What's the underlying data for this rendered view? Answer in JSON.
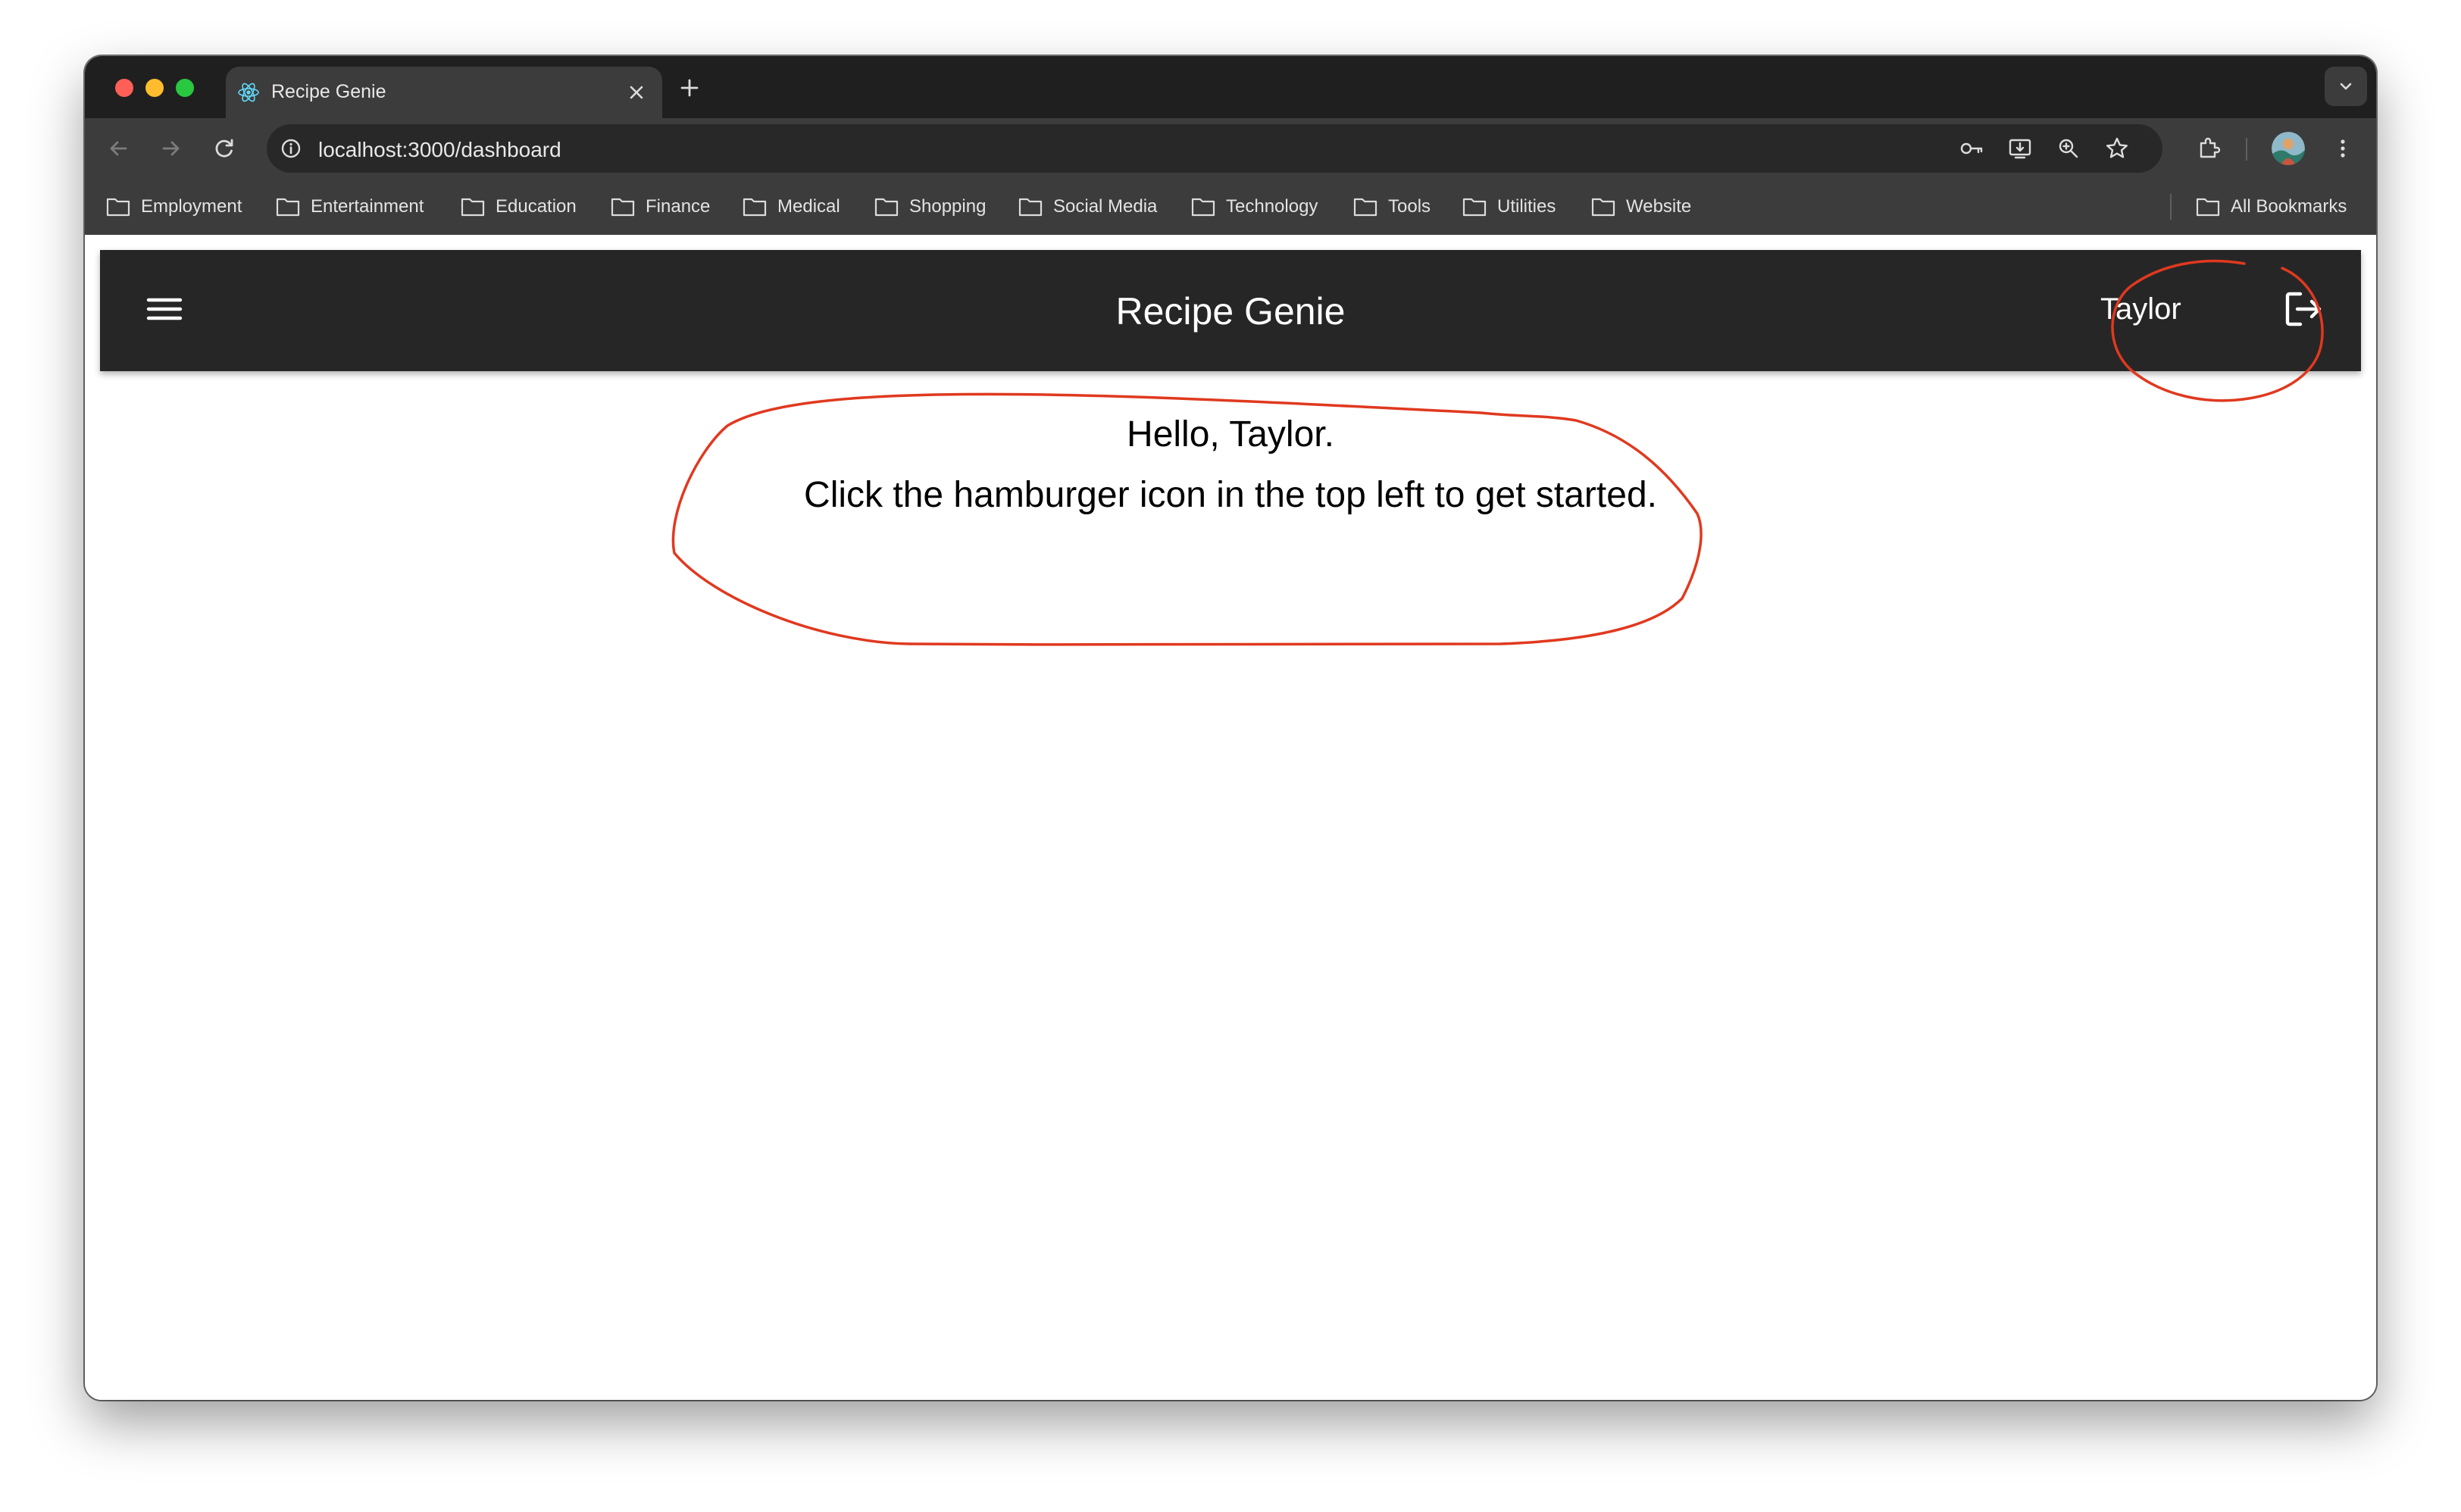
{
  "browser": {
    "tab": {
      "title": "Recipe Genie"
    },
    "url": "localhost:3000/dashboard",
    "bookmarks": [
      "Employment",
      "Entertainment",
      "Education",
      "Finance",
      "Medical",
      "Shopping",
      "Social Media",
      "Technology",
      "Tools",
      "Utilities",
      "Website"
    ],
    "all_bookmarks_label": "All Bookmarks"
  },
  "app": {
    "title": "Recipe Genie",
    "user_name": "Taylor",
    "greeting_line1": "Hello, Taylor.",
    "greeting_line2": "Click the hamburger icon in the top left to get started."
  },
  "colors": {
    "appbar_bg": "#262626",
    "annotation": "#e0391f"
  }
}
